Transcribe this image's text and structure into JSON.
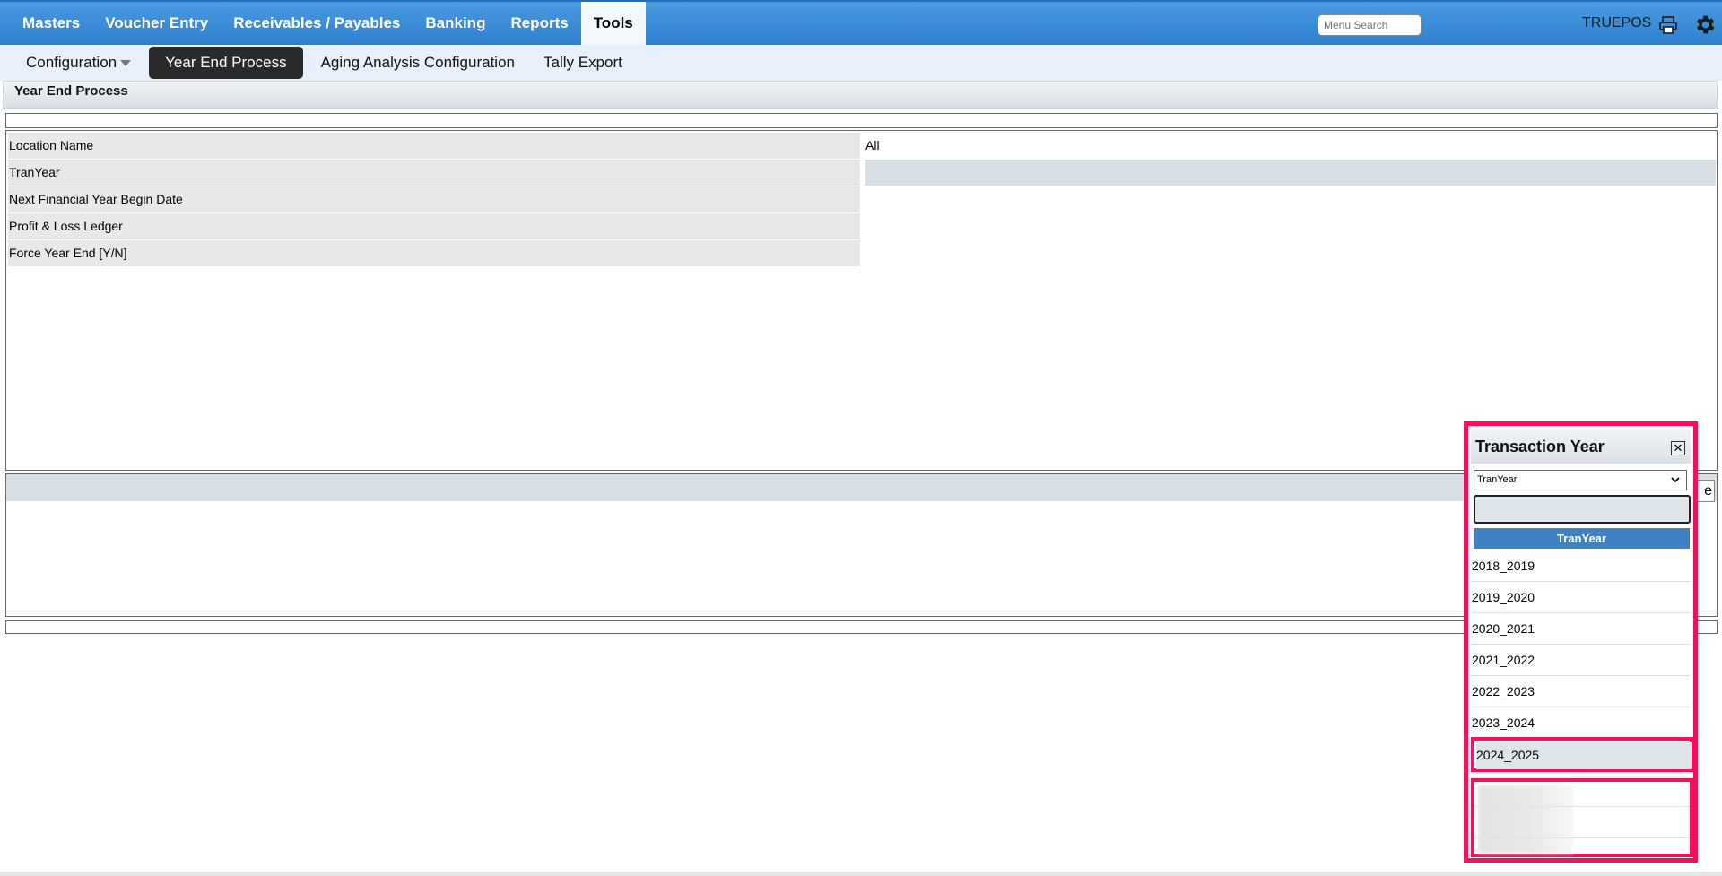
{
  "topnav": {
    "items": [
      "Masters",
      "Voucher Entry",
      "Receivables / Payables",
      "Banking",
      "Reports",
      "Tools"
    ],
    "active": "Tools",
    "search_placeholder": "Menu Search",
    "user": "TRUEPOS"
  },
  "subnav": {
    "items": [
      "Configuration",
      "Year End Process",
      "Aging Analysis Configuration",
      "Tally Export"
    ],
    "active": "Year End Process"
  },
  "panel": {
    "title": "Year End Process"
  },
  "form": {
    "rows": [
      {
        "label": "Location Name",
        "value": "All"
      },
      {
        "label": "TranYear",
        "value": ""
      },
      {
        "label": "Next Financial Year Begin Date",
        "value": ""
      },
      {
        "label": "Profit & Loss Ledger",
        "value": ""
      },
      {
        "label": "Force Year End [Y/N]",
        "value": ""
      }
    ]
  },
  "popup": {
    "title": "Transaction Year",
    "close_glyph": "✕",
    "select_value": "TranYear",
    "grid_header": "TranYear",
    "rows": [
      "2018_2019",
      "2019_2020",
      "2020_2021",
      "2021_2022",
      "2022_2023",
      "2023_2024"
    ],
    "selected_row": "2024_2025"
  },
  "lower": {
    "button_glyph": "e"
  },
  "colors": {
    "nav_blue": "#2f7fd0",
    "highlight": "#f0125a",
    "grid_header": "#3f82c4"
  }
}
